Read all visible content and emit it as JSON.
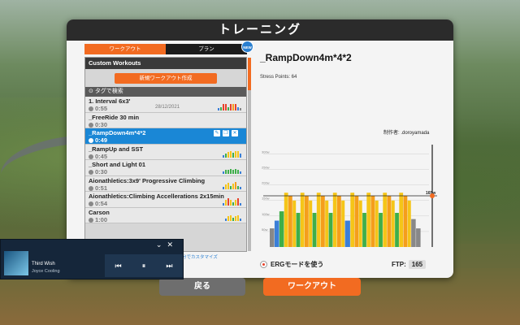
{
  "dialog": {
    "title": "トレーニング"
  },
  "tabs": {
    "workouts": "ワークアウト",
    "plans": "プラン",
    "badge": "NEW"
  },
  "list": {
    "header": "Custom Workouts",
    "create_label": "新規ワークアウト作成",
    "tag_search": "タグで検索",
    "items": [
      {
        "name": "1. Interval 6x3'",
        "duration": "0:55",
        "date": "28/12/2021"
      },
      {
        "name": "_FreeRide 30 min",
        "duration": "0:30",
        "date": ""
      },
      {
        "name": "_RampDown4m*4*2",
        "duration": "0:49",
        "date": ""
      },
      {
        "name": "_RampUp and SST",
        "duration": "0:45",
        "date": ""
      },
      {
        "name": "_Short and Light 01",
        "duration": "0:30",
        "date": ""
      },
      {
        "name": "Aionathletics:3x9' Progressive Climbing",
        "duration": "0:51",
        "date": ""
      },
      {
        "name": "Aionathletics:Climbing Accellerations 2x15min",
        "duration": "0:54",
        "date": ""
      },
      {
        "name": "Carson",
        "duration": "1:00",
        "date": ""
      }
    ]
  },
  "customize_link": "または自分でカスタマイズ",
  "detail": {
    "title": "_RampDown4m*4*2",
    "stress_points": "Stress Points: 64",
    "author": "制作者: .doroyamada",
    "erg_label": "ERGモードを使う",
    "ftp_label": "FTP:",
    "ftp_value": "165"
  },
  "chart_data": {
    "type": "bar",
    "ylabels": [
      "300w",
      "250w",
      "200w",
      "150w",
      "100w",
      "50w"
    ],
    "ylim": [
      0,
      330
    ],
    "ftp_marker_label": "165w",
    "ftp_marker_value": 165,
    "segments": [
      {
        "w": 8,
        "v": 60,
        "c": "#888888"
      },
      {
        "w": 8,
        "v": 85,
        "c": "#3a7fd8"
      },
      {
        "w": 8,
        "v": 115,
        "c": "#3fae49"
      },
      {
        "w": 7,
        "v": 175,
        "c": "#f5c518"
      },
      {
        "w": 7,
        "v": 165,
        "c": "#f59e1b"
      },
      {
        "w": 6,
        "v": 150,
        "c": "#f5c518"
      },
      {
        "w": 7,
        "v": 110,
        "c": "#3fae49"
      },
      {
        "w": 7,
        "v": 175,
        "c": "#f5c518"
      },
      {
        "w": 7,
        "v": 165,
        "c": "#f59e1b"
      },
      {
        "w": 6,
        "v": 150,
        "c": "#f5c518"
      },
      {
        "w": 7,
        "v": 110,
        "c": "#3fae49"
      },
      {
        "w": 7,
        "v": 175,
        "c": "#f5c518"
      },
      {
        "w": 7,
        "v": 165,
        "c": "#f59e1b"
      },
      {
        "w": 6,
        "v": 150,
        "c": "#f5c518"
      },
      {
        "w": 7,
        "v": 110,
        "c": "#3fae49"
      },
      {
        "w": 7,
        "v": 175,
        "c": "#f5c518"
      },
      {
        "w": 7,
        "v": 165,
        "c": "#f59e1b"
      },
      {
        "w": 6,
        "v": 150,
        "c": "#f5c518"
      },
      {
        "w": 9,
        "v": 85,
        "c": "#3a7fd8"
      },
      {
        "w": 7,
        "v": 175,
        "c": "#f5c518"
      },
      {
        "w": 7,
        "v": 165,
        "c": "#f59e1b"
      },
      {
        "w": 6,
        "v": 150,
        "c": "#f5c518"
      },
      {
        "w": 7,
        "v": 110,
        "c": "#3fae49"
      },
      {
        "w": 7,
        "v": 175,
        "c": "#f5c518"
      },
      {
        "w": 7,
        "v": 165,
        "c": "#f59e1b"
      },
      {
        "w": 6,
        "v": 150,
        "c": "#f5c518"
      },
      {
        "w": 7,
        "v": 110,
        "c": "#3fae49"
      },
      {
        "w": 7,
        "v": 175,
        "c": "#f5c518"
      },
      {
        "w": 7,
        "v": 165,
        "c": "#f59e1b"
      },
      {
        "w": 6,
        "v": 150,
        "c": "#f5c518"
      },
      {
        "w": 7,
        "v": 110,
        "c": "#3fae49"
      },
      {
        "w": 7,
        "v": 175,
        "c": "#f5c518"
      },
      {
        "w": 7,
        "v": 165,
        "c": "#f59e1b"
      },
      {
        "w": 6,
        "v": 150,
        "c": "#f5c518"
      },
      {
        "w": 8,
        "v": 90,
        "c": "#888888"
      },
      {
        "w": 8,
        "v": 60,
        "c": "#888888"
      }
    ]
  },
  "buttons": {
    "back": "戻る",
    "workout": "ワークアウト"
  },
  "music": {
    "track": "Third Wish",
    "artist": "Joyce Cooling"
  },
  "colors": {
    "accent": "#f26b21",
    "selected": "#1a87d6"
  }
}
